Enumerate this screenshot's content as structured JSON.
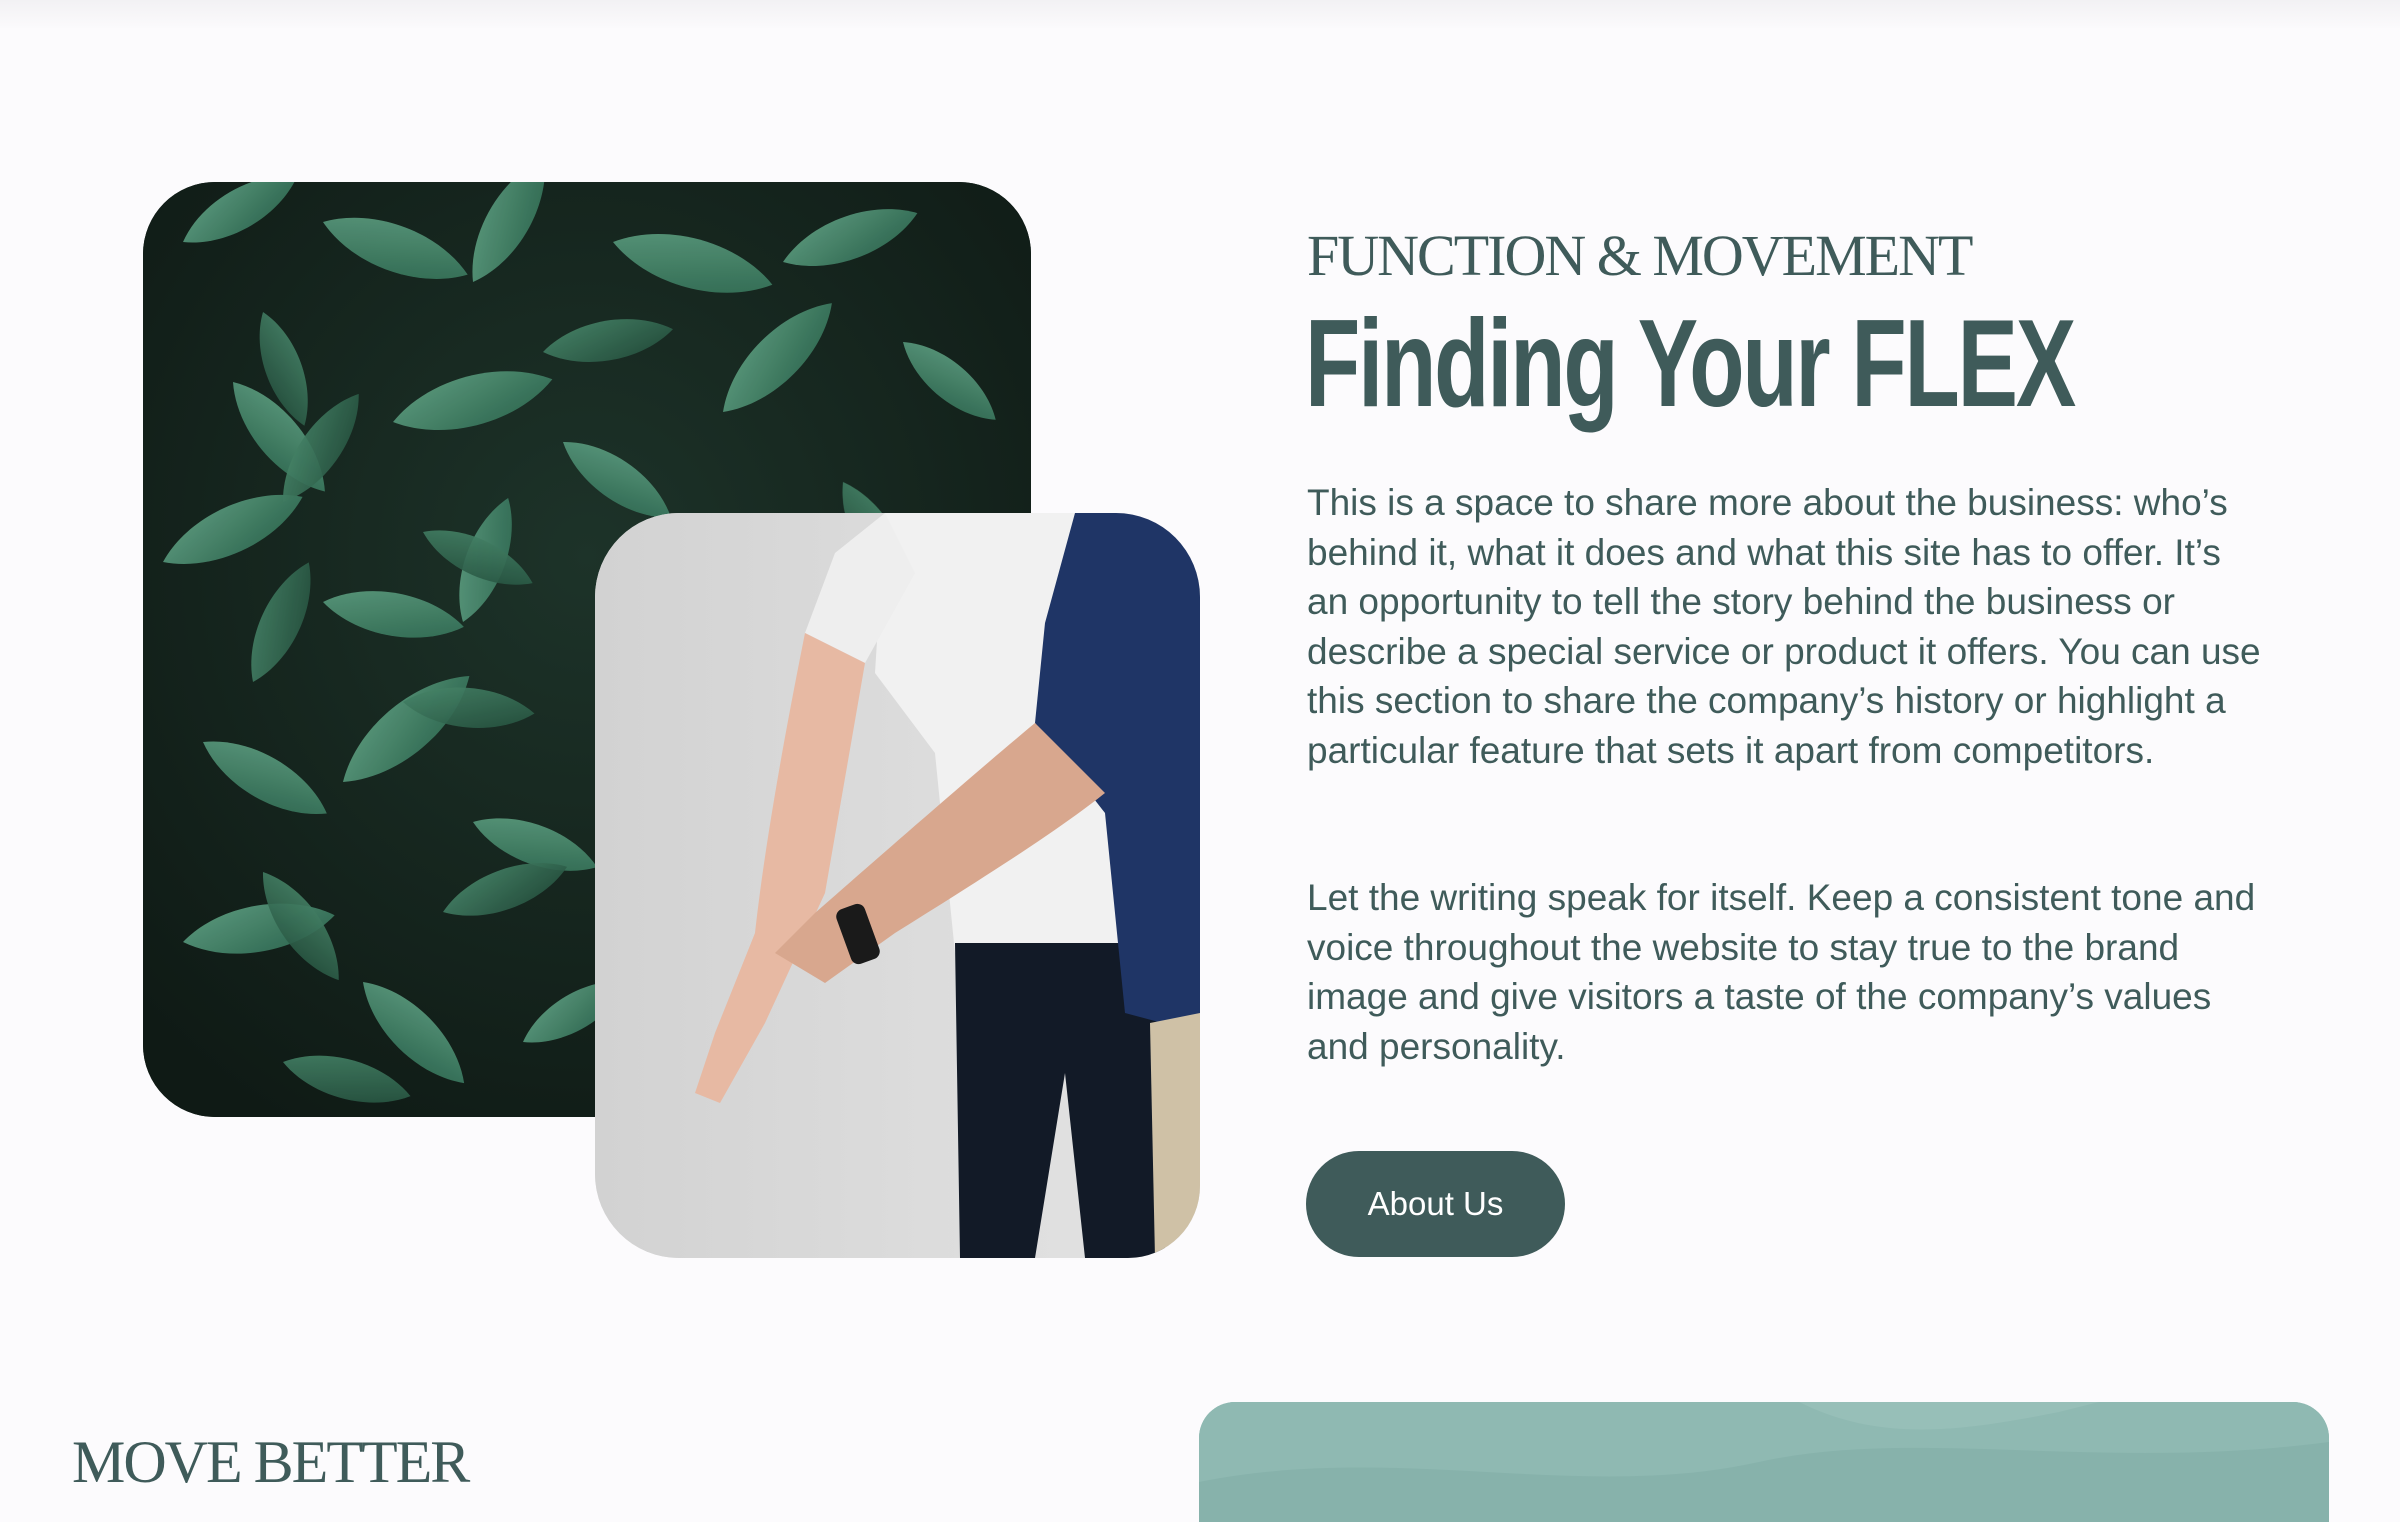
{
  "section": {
    "eyebrow": "FUNCTION & MOVEMENT",
    "title": "Finding Your FLEX",
    "paragraph_1": "This is a space to share more about the business: who’s behind it, what it does and what this site has to offer. It’s an opportunity to tell the story behind the business or describe a special service or product it offers. You can use this section to share the company’s history or highlight a particular feature that sets it apart from competitors.",
    "paragraph_2": "Let the writing speak for itself. Keep a consistent tone and voice throughout the website to stay true to the brand image and give visitors a taste of the company’s values and personality.",
    "button_label": "About Us"
  },
  "next_section": {
    "eyebrow": "MOVE BETTER"
  },
  "colors": {
    "primary": "#3f5b5a",
    "background": "#fcfbfd",
    "accent_card": "#8fb9b2"
  },
  "images": {
    "leaves": "leaves-photo",
    "person": "stretch-assist-photo",
    "teal_card": "teal-card-photo"
  }
}
